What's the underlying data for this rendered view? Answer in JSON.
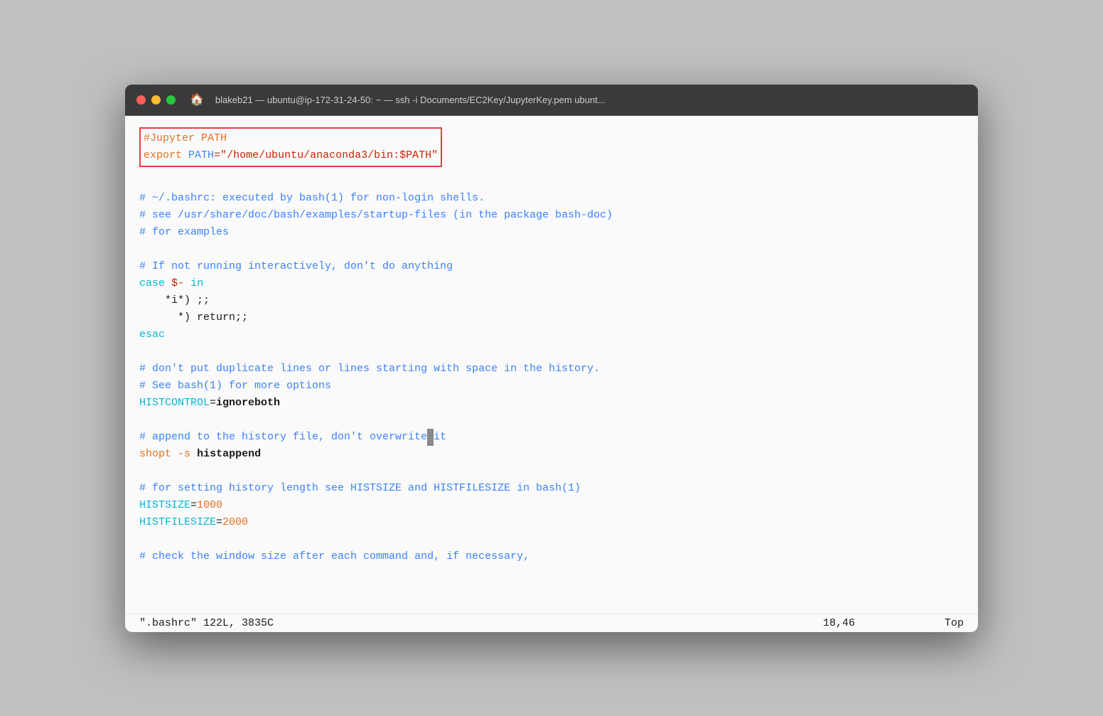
{
  "window": {
    "title": "blakeb21 — ubuntu@ip-172-31-24-50: ~ — ssh -i Documents/EC2Key/JupyterKey.pem ubunt..."
  },
  "trafficLights": {
    "close": "close",
    "minimize": "minimize",
    "maximize": "maximize"
  },
  "code": {
    "highlighted_line1": "#Jupyter PATH",
    "highlighted_line2": "export PATH=\"/home/ubuntu/anaconda3/bin:$PATH\"",
    "blank1": "",
    "comment1": "# ~/.bashrc: executed by bash(1) for non-login shells.",
    "comment2": "# see /usr/share/doc/bash/examples/startup-files (in the package bash-doc)",
    "comment3": "# for examples",
    "blank2": "",
    "comment4": "# If not running interactively, don't do anything",
    "case_line": "case $- in",
    "case_i": "    *i*) ;;",
    "case_star": "      *) return;;",
    "esac": "esac",
    "blank3": "",
    "comment5": "# don't put duplicate lines or lines starting with space in the history.",
    "comment6": "# See bash(1) for more options",
    "histcontrol": "HISTCONTROL=ignoreboth",
    "blank4": "",
    "comment7": "# append to the history file, don't overwrite it",
    "shopt": "shopt -s histappend",
    "blank5": "",
    "comment8": "# for setting history length see HISTSIZE and HISTFILESIZE in bash(1)",
    "histsize": "HISTSIZE=1000",
    "histfilesize": "HISTFILESIZE=2000",
    "blank6": "",
    "comment9": "# check the window size after each command and, if necessary,"
  },
  "statusbar": {
    "fileinfo": "\".bashrc\" 122L, 3835C",
    "position": "18,46",
    "scroll": "Top"
  }
}
